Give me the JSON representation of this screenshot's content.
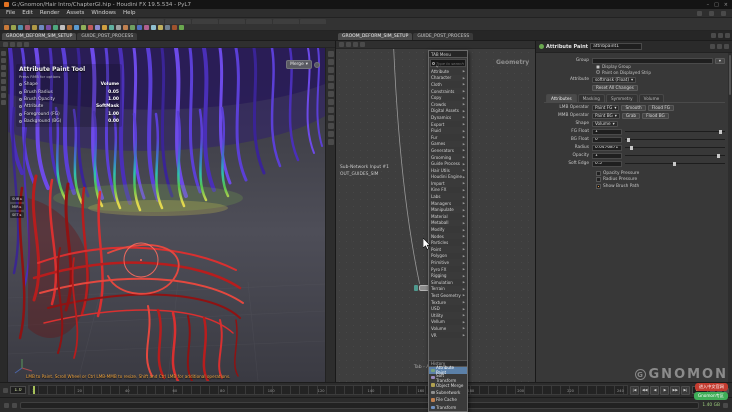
{
  "window": {
    "title": "G:/Gnomon/Hair Intro/ChapterGI.hip - Houdini FX 19.5.534 - PyL7",
    "controls": {
      "min": "–",
      "max": "□",
      "close": "×"
    }
  },
  "menubar": {
    "items": [
      "File",
      "Edit",
      "Render",
      "Assets",
      "Windows",
      "Help"
    ]
  },
  "shelf": {
    "icon_colors": [
      "#c97a3a",
      "#9aa64e",
      "#4e90b0",
      "#a85a6e",
      "#b09a46",
      "#6e8ac0",
      "#7a4ea8",
      "#4ea87e",
      "#c0c0c0",
      "#b0703a",
      "#5a9ad0",
      "#90b05a",
      "#c05a5a",
      "#8a8ad0",
      "#d0a040",
      "#60b0a0",
      "#a0a0a0",
      "#c08050",
      "#70a060",
      "#5070c0",
      "#b06090",
      "#90c0d0",
      "#c0b060",
      "#708090",
      "#a0522d",
      "#6aa84f"
    ]
  },
  "panes": {
    "scene_tabs": [
      {
        "label": "GROOM_DEFORM_SIM_SETUP",
        "state": "active"
      },
      {
        "label": "GUIDE_POST_PROCESS",
        "state": ""
      }
    ],
    "network_tabs": [
      {
        "label": "GROOM_DEFORM_SIM_SETUP",
        "state": "active"
      },
      {
        "label": "GUIDE_POST_PROCESS",
        "state": ""
      }
    ]
  },
  "viewport": {
    "hud": {
      "title": "Attribute Paint Tool",
      "subtitle": "Press RMB for options",
      "rows": [
        {
          "label": "Shape",
          "value": "Volume"
        },
        {
          "label": "Brush Radius",
          "value": "0.05"
        },
        {
          "label": "Brush Opacity",
          "value": "1.00"
        },
        {
          "label": "Attribute",
          "value": "SoftMask"
        },
        {
          "label": "Foreground (FG)",
          "value": "1.00"
        },
        {
          "label": "Background (BG)",
          "value": "0.00"
        }
      ]
    },
    "side_buttons": [
      "SUB",
      "MIR",
      "SET"
    ],
    "merge_button": "Merge",
    "prompt": "LMB to Paint.  Scroll Wheel or Ctrl LMB-MMB to resize.  Shift and Ctrl LMB for additional operations."
  },
  "network": {
    "context_label": "Geometry",
    "note_line1": "Sub-Network Input #1",
    "note_line2": "OUT_GUIDES_SIM",
    "node_label": "attribpaint1",
    "hint": "Tab - Add Operator"
  },
  "tab_menu": {
    "title": "TAB Menu",
    "search_placeholder": "Type to search...",
    "categories": [
      "Attribute",
      "Character",
      "Cloth",
      "Constraints",
      "Copy",
      "Crowds",
      "Digital Assets",
      "Dynamics",
      "Export",
      "Fluid",
      "Fur",
      "Games",
      "Generators",
      "Grooming",
      "Guide Process",
      "Hair Utils",
      "Houdini Engine",
      "Import",
      "Kine FX",
      "Labs",
      "Managers",
      "Manipulate",
      "Material",
      "Metaball",
      "Modify",
      "Nodes",
      "Particles",
      "Point",
      "Polygon",
      "Primitive",
      "Pyro FX",
      "Rigging",
      "Simulation",
      "Terrain",
      "Test Geometry",
      "Texture",
      "USD",
      "Utility",
      "Vellum",
      "Volume",
      "VR"
    ],
    "history_label": "History",
    "history": [
      {
        "label": "Attribute Paint",
        "state": "selected",
        "color": "#76a07a"
      },
      {
        "label": "Soft Transform",
        "state": "",
        "color": "#9a8ac0"
      },
      {
        "label": "Object Merge",
        "state": "",
        "color": "#b0a050"
      },
      {
        "label": "Subnetwork",
        "state": "",
        "color": "#909090"
      },
      {
        "label": "File Cache",
        "state": "",
        "color": "#c08050"
      },
      {
        "label": "Transform",
        "state": "",
        "color": "#7090c0"
      }
    ]
  },
  "params": {
    "title": "Attribute Paint",
    "node_name": "attribpaint1",
    "group_label": "Group",
    "group_options": [
      {
        "label": "Display Group",
        "state": "on"
      },
      {
        "label": "Paint on Displayed Strip",
        "state": ""
      }
    ],
    "attribute_label": "Attribute",
    "attribute_value": "softmask (Float)",
    "reset_label": "Reset All Changes",
    "tabs": [
      {
        "label": "Attributes",
        "state": "active"
      },
      {
        "label": "Masking",
        "state": ""
      },
      {
        "label": "Symmetry",
        "state": ""
      },
      {
        "label": "Volume",
        "state": ""
      }
    ],
    "lmb": {
      "label": "LMB Operator",
      "value": "Paint FG",
      "b1": "Smooth",
      "b2": "Flood FG"
    },
    "mmb": {
      "label": "MMB Operator",
      "value": "Paint BG",
      "b1": "Grab",
      "b2": "Flood BG"
    },
    "shape": {
      "label": "Shape",
      "value": "Volume"
    },
    "fg": {
      "label": "FG Float",
      "value": "1"
    },
    "bg": {
      "label": "BG Float",
      "value": "0"
    },
    "radius": {
      "label": "Radius",
      "value": "0.0476871"
    },
    "opacity": {
      "label": "Opacity",
      "value": "1"
    },
    "soft_edge": {
      "label": "Soft Edge",
      "value": "0.5"
    },
    "toggles": [
      {
        "label": "Opacity Pressure",
        "state": ""
      },
      {
        "label": "Radius Pressure",
        "state": ""
      },
      {
        "label": "Show Brush Path",
        "state": "on"
      }
    ]
  },
  "playbar": {
    "current": "1.0",
    "end": "240",
    "ticks": [
      "1",
      "20",
      "40",
      "60",
      "80",
      "100",
      "120",
      "140",
      "160",
      "180",
      "200",
      "220",
      "240"
    ],
    "transport": [
      "|◀",
      "◀◀",
      "◀",
      "▶",
      "▶▶",
      "▶|"
    ]
  },
  "statusbar": {
    "memory": "1.40 GB"
  },
  "watermark": {
    "brand": "GNOMON",
    "logo_letter": "G",
    "badge_red": "进入中文官网",
    "badge_green": "Gnomon专区"
  },
  "icons": {
    "submenu_arrow": "▶",
    "dropdown": "▾",
    "chevron": "▸"
  },
  "colors": {
    "prompt_orange": "#f0a43c",
    "selection_blue": "#5b80a8",
    "hair_purple": "#5b3fd6",
    "hair_red": "#c42222"
  }
}
